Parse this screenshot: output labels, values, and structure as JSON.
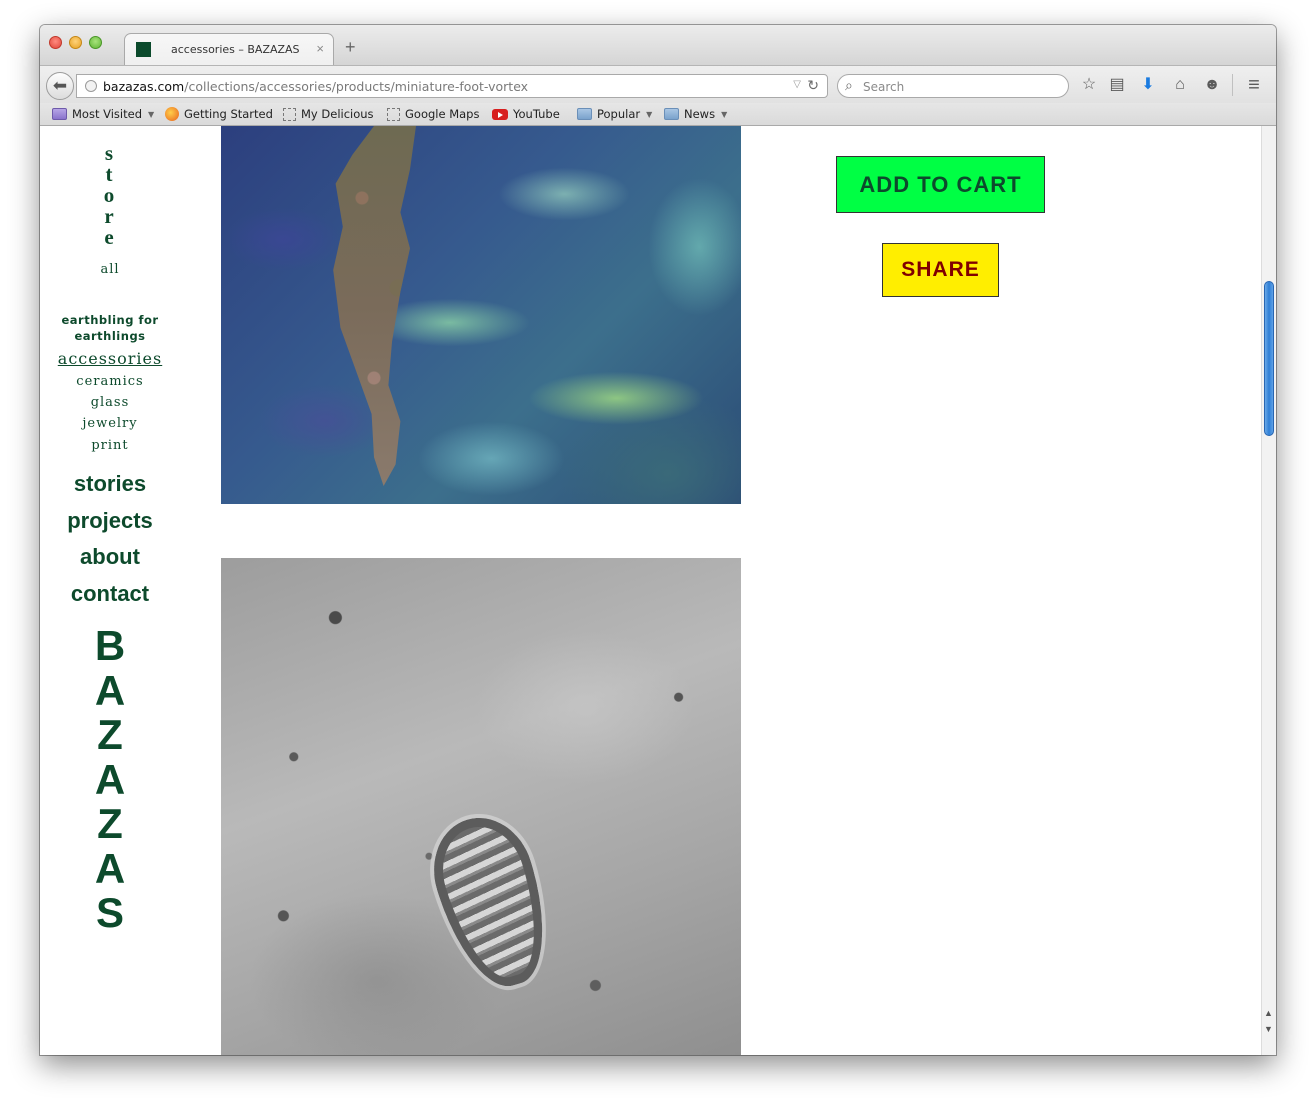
{
  "browser": {
    "tab_title": "accessories – BAZAZAS",
    "tab_close": "×",
    "new_tab": "+",
    "back": "⬅",
    "url_host": "bazazas.com",
    "url_path": "/collections/accessories/products/miniature-foot-vortex",
    "url_dropdown": "▽",
    "reload": "↻",
    "search_placeholder": "Search",
    "toolbar_icons": {
      "bookmark": "☆",
      "reading_list": "▤",
      "downloads": "⬇",
      "home": "⌂",
      "chat": "☻",
      "menu": "≡"
    },
    "bookmarks": [
      {
        "label": "Most Visited",
        "icon": "smart-folder",
        "dropdown": true
      },
      {
        "label": "Getting Started",
        "icon": "firefox",
        "dropdown": false
      },
      {
        "label": "My Delicious",
        "icon": "dashed-page",
        "dropdown": false
      },
      {
        "label": "Google Maps",
        "icon": "dashed-page",
        "dropdown": false
      },
      {
        "label": "YouTube",
        "icon": "youtube",
        "dropdown": false
      },
      {
        "label": "Popular",
        "icon": "folder",
        "dropdown": true
      },
      {
        "label": "News",
        "icon": "folder",
        "dropdown": true
      }
    ]
  },
  "sidebar": {
    "store_letters": [
      "s",
      "t",
      "o",
      "r",
      "e"
    ],
    "store_links": [
      {
        "label": "all"
      },
      {
        "label": "earthbling for earthlings"
      },
      {
        "label": "accessories",
        "active": true
      },
      {
        "label": "ceramics"
      },
      {
        "label": "glass"
      },
      {
        "label": "jewelry"
      },
      {
        "label": "print"
      }
    ],
    "main_links": [
      "stories",
      "projects",
      "about",
      "contact"
    ],
    "brand_letters": [
      "B",
      "A",
      "Z",
      "A",
      "Z",
      "A",
      "S"
    ]
  },
  "product": {
    "add_to_cart": "ADD TO CART",
    "share": "SHARE"
  },
  "colors": {
    "brand_green": "#0d4a2c",
    "cart_button": "#00ff44",
    "share_button": "#ffee00",
    "share_text": "#800000"
  }
}
